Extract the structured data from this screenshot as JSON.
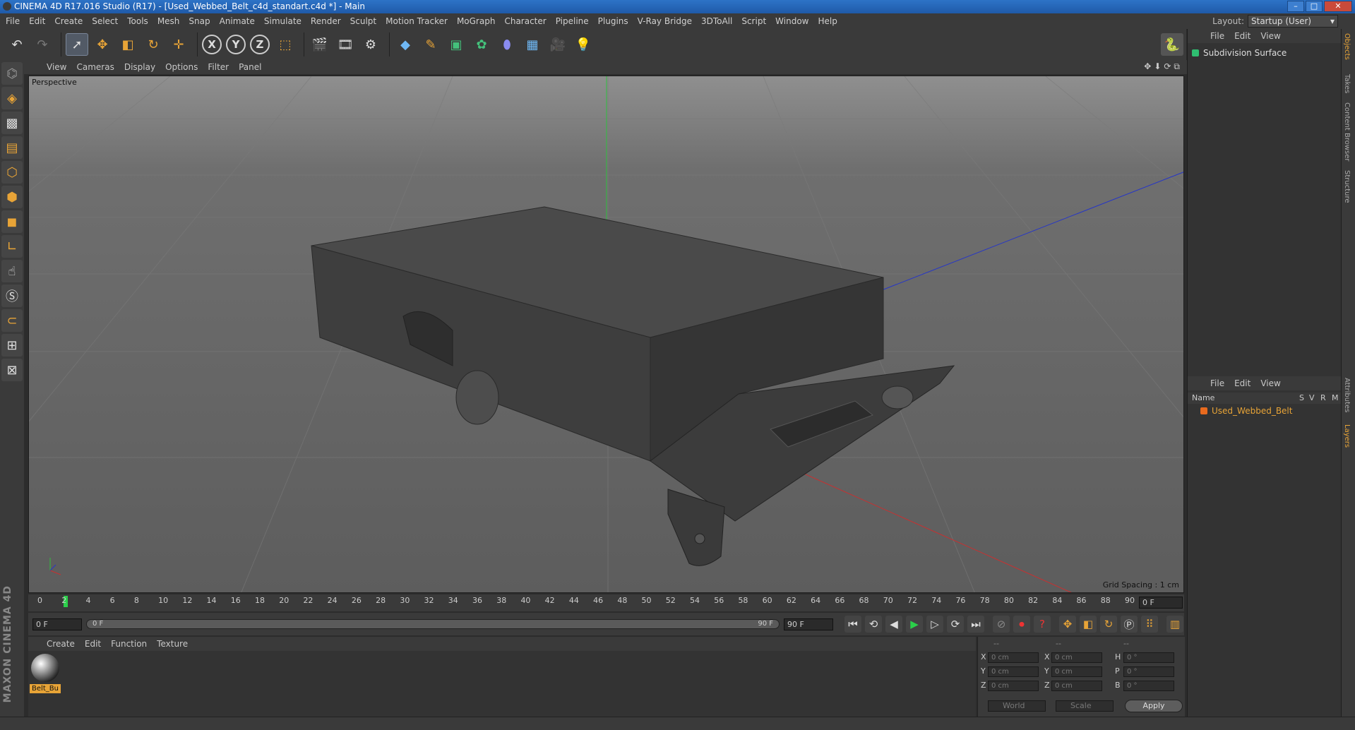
{
  "window": {
    "title": "CINEMA 4D R17.016 Studio (R17) - [Used_Webbed_Belt_c4d_standart.c4d *] - Main"
  },
  "menubar": [
    "File",
    "Edit",
    "Create",
    "Select",
    "Tools",
    "Mesh",
    "Snap",
    "Animate",
    "Simulate",
    "Render",
    "Sculpt",
    "Motion Tracker",
    "MoGraph",
    "Character",
    "Pipeline",
    "Plugins",
    "V-Ray Bridge",
    "3DToAll",
    "Script",
    "Window",
    "Help"
  ],
  "layout": {
    "label": "Layout:",
    "value": "Startup (User)"
  },
  "toolbar": {
    "axis_x": "X",
    "axis_y": "Y",
    "axis_z": "Z"
  },
  "viewport": {
    "menu": [
      "View",
      "Cameras",
      "Display",
      "Options",
      "Filter",
      "Panel"
    ],
    "label": "Perspective",
    "grid_spacing": "Grid Spacing : 1 cm"
  },
  "timeline": {
    "ticks": [
      "0",
      "2",
      "4",
      "6",
      "8",
      "10",
      "12",
      "14",
      "16",
      "18",
      "20",
      "22",
      "24",
      "26",
      "28",
      "30",
      "32",
      "34",
      "36",
      "38",
      "40",
      "42",
      "44",
      "46",
      "48",
      "50",
      "52",
      "54",
      "56",
      "58",
      "60",
      "62",
      "64",
      "66",
      "68",
      "70",
      "72",
      "74",
      "76",
      "78",
      "80",
      "82",
      "84",
      "86",
      "88",
      "90"
    ],
    "current_frame": "0 F"
  },
  "playbar": {
    "start": "0 F",
    "range_start": "0 F",
    "range_end": "90 F",
    "end": "90 F"
  },
  "material_manager": {
    "menu": [
      "Create",
      "Edit",
      "Function",
      "Texture"
    ],
    "materials": [
      {
        "name": "Belt_Bu"
      }
    ]
  },
  "coordinates": {
    "header": [
      "--",
      "--",
      "--"
    ],
    "rows": [
      {
        "a": "X",
        "av": "0 cm",
        "b": "X",
        "bv": "0 cm",
        "c": "H",
        "cv": "0 °"
      },
      {
        "a": "Y",
        "av": "0 cm",
        "b": "Y",
        "bv": "0 cm",
        "c": "P",
        "cv": "0 °"
      },
      {
        "a": "Z",
        "av": "0 cm",
        "b": "Z",
        "bv": "0 cm",
        "c": "B",
        "cv": "0 °"
      }
    ],
    "mode": "World",
    "transform": "Scale",
    "apply": "Apply"
  },
  "object_manager": {
    "menu": [
      "File",
      "Edit",
      "View"
    ],
    "objects": [
      {
        "name": "Subdivision Surface"
      }
    ]
  },
  "layer_manager": {
    "menu": [
      "File",
      "Edit",
      "View"
    ],
    "columns": {
      "name": "Name",
      "s": "S",
      "v": "V",
      "r": "R",
      "m": "M"
    },
    "layers": [
      {
        "name": "Used_Webbed_Belt"
      }
    ]
  },
  "side_tabs": [
    "Objects",
    "Takes",
    "Content Browser",
    "Structure",
    "Attributes",
    "Layers"
  ],
  "brand": "MAXON CINEMA 4D",
  "colors": {
    "accent": "#e8a437",
    "timeline_cursor": "#2bd04a",
    "layer": "#e86a1e"
  }
}
